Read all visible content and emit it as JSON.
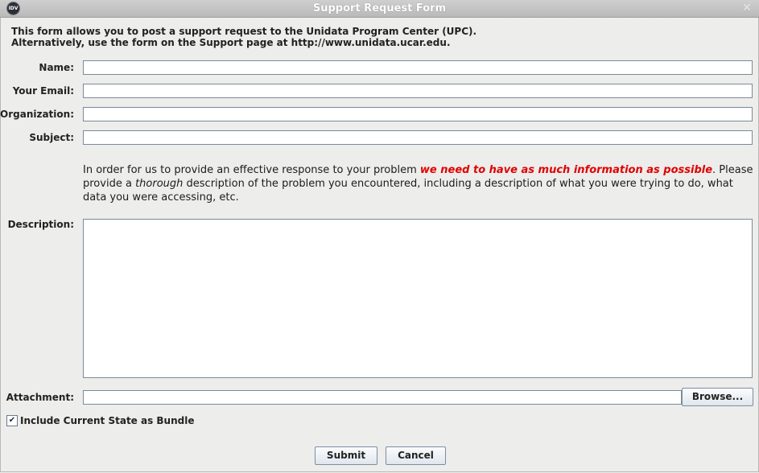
{
  "window": {
    "title": "Support Request Form",
    "app_icon_text": "IDV"
  },
  "intro": {
    "line1": "This form allows you to post a support request to the Unidata Program Center (UPC).",
    "line2": "Alternatively, use the form on the Support page at http://www.unidata.ucar.edu."
  },
  "fields": {
    "name_label": "Name:",
    "name_value": "",
    "email_label": "Your Email:",
    "email_value": "",
    "organization_label": "Organization:",
    "organization_value": "",
    "subject_label": "Subject:",
    "subject_value": ""
  },
  "info": {
    "part1": "In order for us to provide an effective response to your problem ",
    "emphasis": "we need to have as much information as possible",
    "part2": ". Please provide a ",
    "italic": "thorough",
    "part3": " description of the problem you encountered, including a description of what you were trying to do, what data you were accessing, etc."
  },
  "description": {
    "label": "Description:",
    "value": ""
  },
  "attachment": {
    "label": "Attachment:",
    "value": "",
    "browse_label": "Browse..."
  },
  "bundle": {
    "label": "Include Current State as Bundle",
    "checked": true
  },
  "buttons": {
    "submit_label": "Submit",
    "cancel_label": "Cancel"
  }
}
